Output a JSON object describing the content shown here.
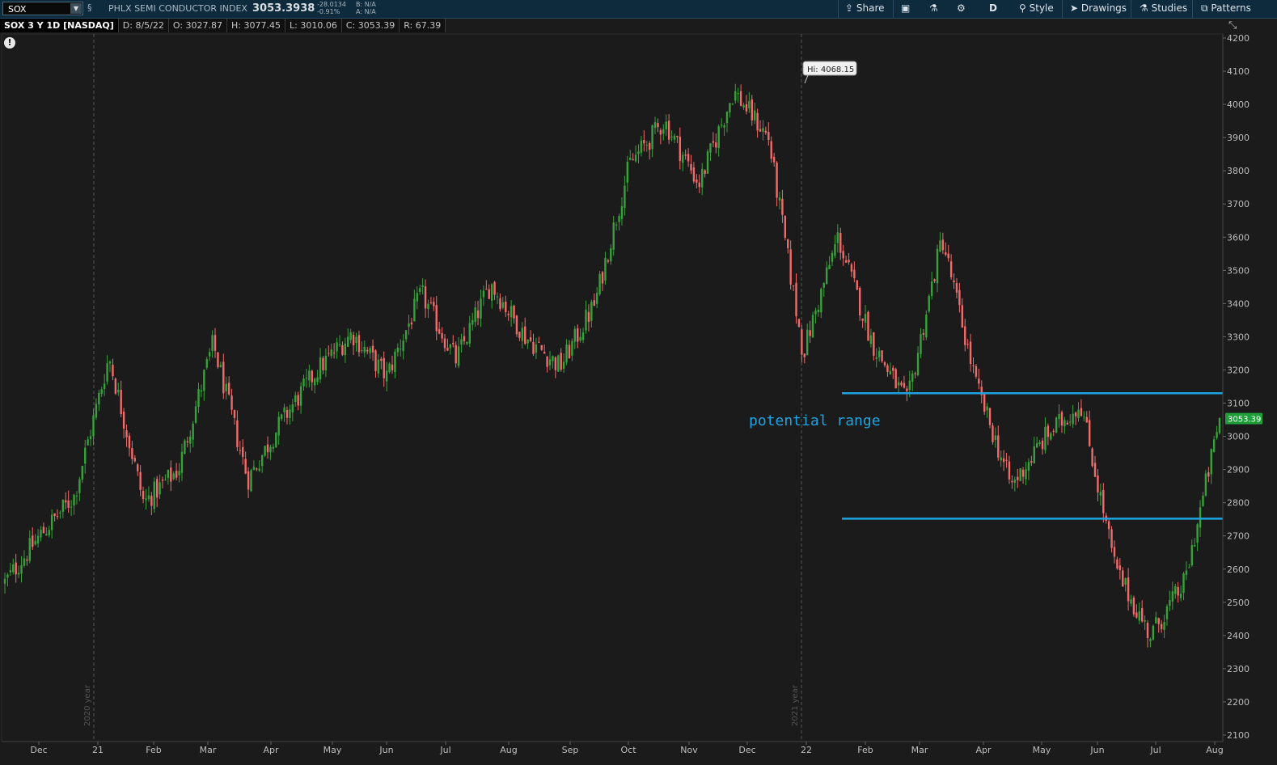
{
  "header": {
    "symbol": "SOX",
    "index_name": "PHLX SEMI CONDUCTOR INDEX",
    "last": "3053.3938",
    "change": "-28.0134",
    "change_pct": "-0.91%",
    "bid": "B: N/A",
    "ask": "A: N/A",
    "period": "D",
    "share_label": "Share",
    "style_label": "Style",
    "drawings_label": "Drawings",
    "studies_label": "Studies",
    "patterns_label": "Patterns"
  },
  "infobar": {
    "title": "SOX 3 Y 1D [NASDAQ]",
    "date": "D: 8/5/22",
    "open": "O: 3027.87",
    "high": "H: 3077.45",
    "low": "L: 3010.06",
    "close": "C: 3053.39",
    "range": "R: 67.39"
  },
  "colors": {
    "up": "#37a23a",
    "down": "#f26b6b",
    "background": "#1b1b1b",
    "annotation": "#1fa3e0",
    "grid_divider": "#555555"
  },
  "chart_data": {
    "type": "candlestick",
    "ylim": [
      2100,
      4200
    ],
    "yticks": [
      4200,
      4100,
      4000,
      3900,
      3800,
      3700,
      3600,
      3500,
      3400,
      3300,
      3200,
      3100,
      3000,
      2900,
      2800,
      2700,
      2600,
      2500,
      2400,
      2300,
      2200,
      2100
    ],
    "xlabels": [
      "Dec",
      "21",
      "Feb",
      "Mar",
      "Apr",
      "May",
      "Jun",
      "Jul",
      "Aug",
      "Sep",
      "Oct",
      "Nov",
      "Dec",
      "22",
      "Feb",
      "Mar",
      "Apr",
      "May",
      "Jun",
      "Jul",
      "Aug"
    ],
    "year_markers": [
      "2020 year",
      "2021 year"
    ],
    "price_path": [
      {
        "x": "Nov 2020",
        "y": 2560
      },
      {
        "x": "Dec 2020",
        "y": 2700
      },
      {
        "x": "Jan 2021",
        "y": 2820
      },
      {
        "x": "Feb 2021",
        "y": 3240
      },
      {
        "x": "Mar 2021",
        "y": 2800
      },
      {
        "x": "Mar 2021",
        "y": 2900
      },
      {
        "x": "Apr 2021",
        "y": 3280
      },
      {
        "x": "May 2021",
        "y": 2870
      },
      {
        "x": "May 2021",
        "y": 3050
      },
      {
        "x": "Jun 2021",
        "y": 3200
      },
      {
        "x": "Jul 2021",
        "y": 3310
      },
      {
        "x": "Jul 2021",
        "y": 3180
      },
      {
        "x": "Aug 2021",
        "y": 3430
      },
      {
        "x": "Aug 2021",
        "y": 3230
      },
      {
        "x": "Sep 2021",
        "y": 3460
      },
      {
        "x": "Sep 2021",
        "y": 3300
      },
      {
        "x": "Oct 2021",
        "y": 3210
      },
      {
        "x": "Oct 2021",
        "y": 3400
      },
      {
        "x": "Nov 2021",
        "y": 3820
      },
      {
        "x": "Nov 2021",
        "y": 3950
      },
      {
        "x": "Dec 2021",
        "y": 3760
      },
      {
        "x": "Dec 2021",
        "y": 4040
      },
      {
        "x": "Jan 2022",
        "y": 3900
      },
      {
        "x": "Jan 2022",
        "y": 3250
      },
      {
        "x": "Feb 2022",
        "y": 3600
      },
      {
        "x": "Feb 2022",
        "y": 3280
      },
      {
        "x": "Mar 2022",
        "y": 3100
      },
      {
        "x": "Apr 2022",
        "y": 3600
      },
      {
        "x": "Apr 2022",
        "y": 3150
      },
      {
        "x": "May 2022",
        "y": 2850
      },
      {
        "x": "May 2022",
        "y": 3000
      },
      {
        "x": "Jun 2022",
        "y": 3100
      },
      {
        "x": "Jun 2022",
        "y": 2600
      },
      {
        "x": "Jul 2022",
        "y": 2400
      },
      {
        "x": "Jul 2022",
        "y": 2560
      },
      {
        "x": "Aug 2022",
        "y": 3053
      }
    ],
    "high_label": "Hi: 4068.15",
    "last_label": "3053.39",
    "annotations": [
      {
        "type": "hline",
        "y": 3130
      },
      {
        "type": "hline",
        "y": 2752
      },
      {
        "type": "text",
        "text": "potential range"
      }
    ]
  }
}
